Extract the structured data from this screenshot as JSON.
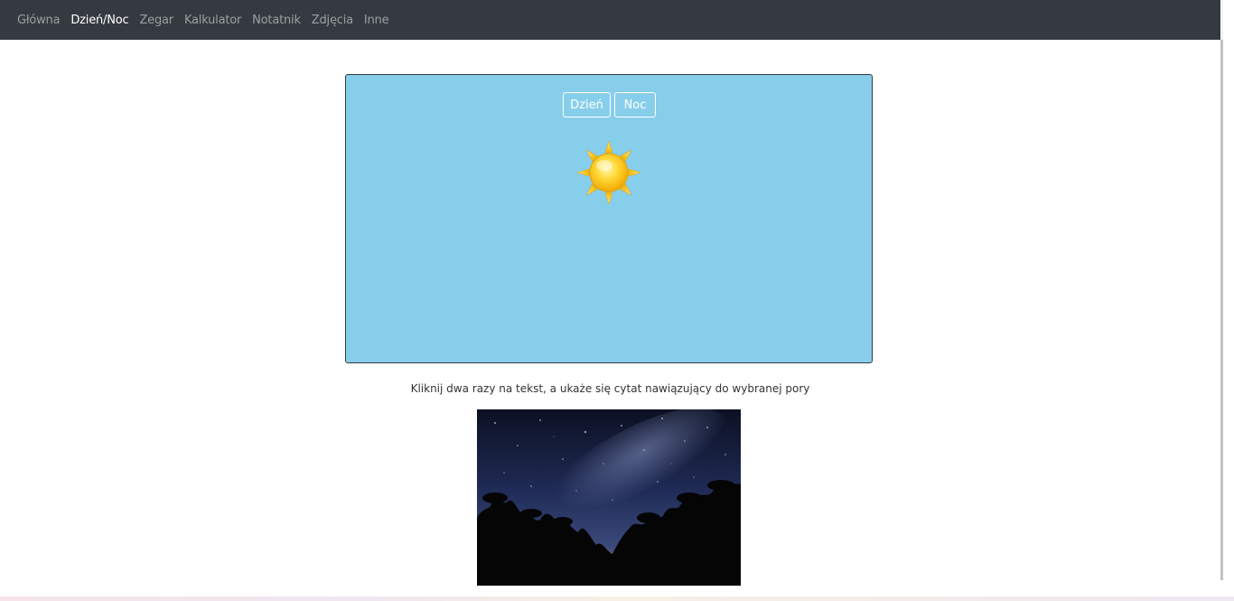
{
  "nav": {
    "items": [
      {
        "label": "Główna",
        "active": false
      },
      {
        "label": "Dzień/Noc",
        "active": true
      },
      {
        "label": "Zegar",
        "active": false
      },
      {
        "label": "Kalkulator",
        "active": false
      },
      {
        "label": "Notatnik",
        "active": false
      },
      {
        "label": "Zdjęcia",
        "active": false
      },
      {
        "label": "Inne",
        "active": false
      }
    ]
  },
  "scene": {
    "mode": "day",
    "background_color": "#87ceeb",
    "buttons": {
      "day_label": "Dzień",
      "night_label": "Noc"
    },
    "icon": "sun-icon"
  },
  "caption": "Kliknij dwa razy na tekst, a ukaże się cytat nawiązujący do wybranej pory",
  "photo": {
    "alt": "night-sky-palm-trees-photo"
  },
  "colors": {
    "navbar": "#343a40",
    "nav_text": "rgba(255,255,255,0.5)",
    "nav_active_text": "#ffffff",
    "sky_day": "#87ceeb"
  }
}
